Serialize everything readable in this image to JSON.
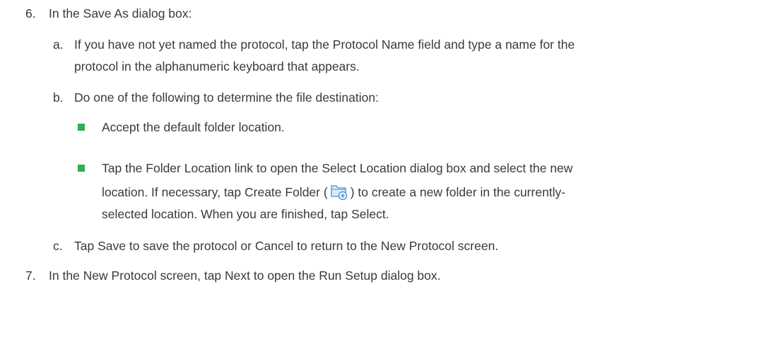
{
  "steps": [
    {
      "number": "6.",
      "text": "In the Save As dialog box:",
      "substeps": [
        {
          "letter": "a.",
          "line1": "If you have not yet named the protocol, tap the Protocol Name field and type a name for the",
          "line2": "protocol in the alphanumeric keyboard that appears."
        },
        {
          "letter": "b.",
          "line1": "Do one of the following to determine the file destination:",
          "bullets": [
            {
              "line1": "Accept the default folder location."
            },
            {
              "line1": "Tap the Folder Location link to open the Select Location dialog box and select the new",
              "line2_pre": "location. If necessary, tap Create Folder (",
              "line2_post": ") to create a new folder in the currently-",
              "line3": "selected location. When you are finished, tap Select."
            }
          ]
        },
        {
          "letter": "c.",
          "line1": "Tap Save to save the protocol or Cancel to return to the New Protocol screen."
        }
      ]
    },
    {
      "number": "7.",
      "text": "In the New Protocol screen, tap Next to open the Run Setup dialog box."
    }
  ],
  "icons": {
    "bullet": "green-square-bullet",
    "create_folder": "create-folder-icon"
  },
  "colors": {
    "text": "#3a3a3a",
    "bullet": "#2fae4e",
    "icon_blue": "#4a90d9"
  }
}
